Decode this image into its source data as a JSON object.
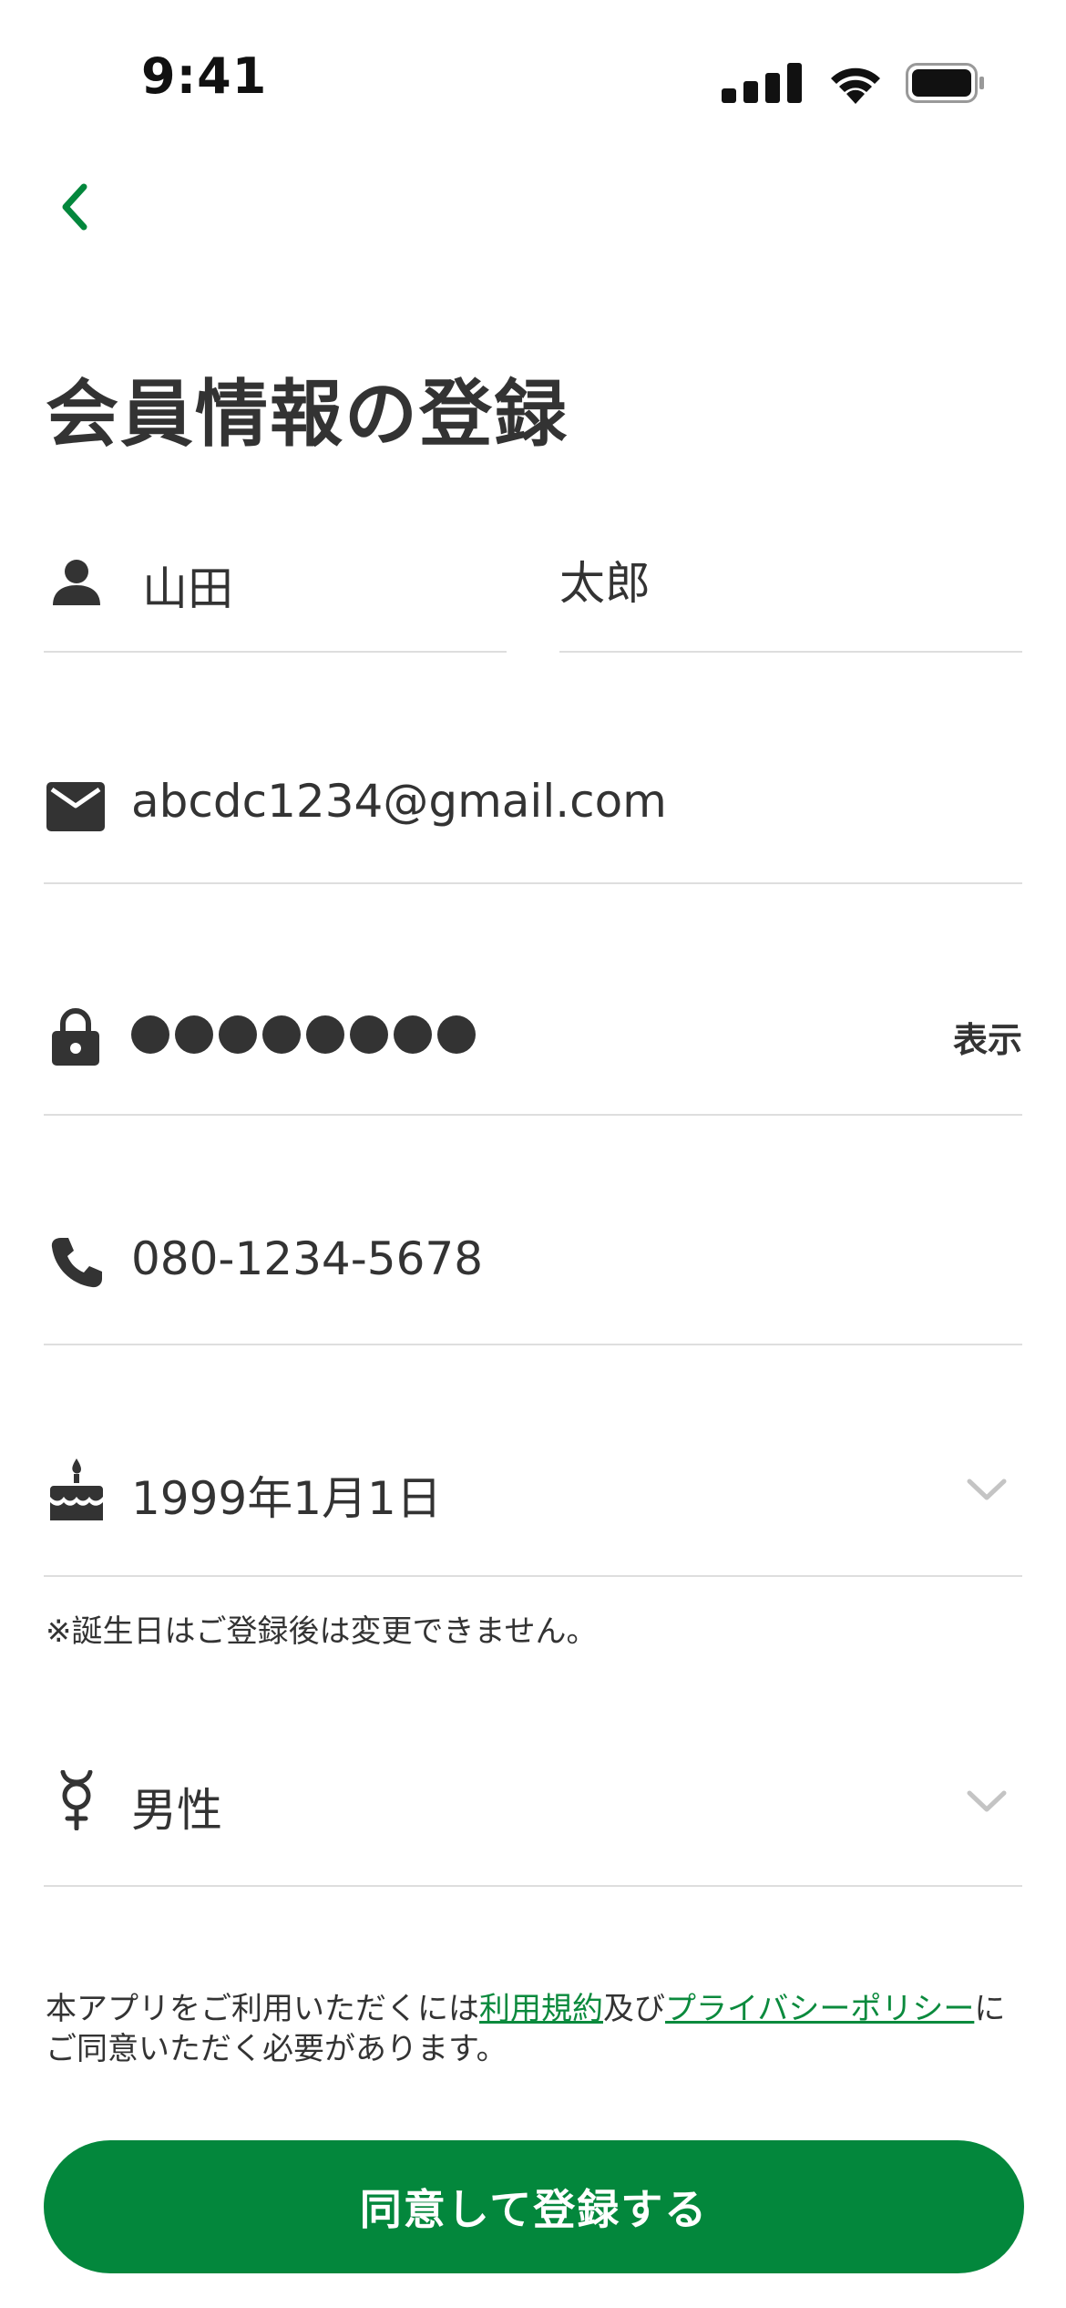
{
  "status_bar": {
    "time": "9:41"
  },
  "header": {
    "back_icon": "chevron-left-icon",
    "title": "会員情報の登録"
  },
  "form": {
    "last_name": "山田",
    "first_name": "太郎",
    "email": "abcdc1234@gmail.com",
    "password_dot_count": 8,
    "show_password_label": "表示",
    "phone": "080-1234-5678",
    "birthday": "1999年1月1日",
    "birthday_note": "※誕生日はご登録後は変更できません。",
    "gender": "男性"
  },
  "terms": {
    "prefix": "本アプリをご利用いただくには",
    "terms_link": "利用規約",
    "middle": "及び",
    "privacy_link": "プライバシーポリシー",
    "suffix": "にご同意いただく必要があります。"
  },
  "submit_label": "同意して登録する",
  "colors": {
    "accent": "#03873c",
    "text": "#333333",
    "divider": "#dedede"
  }
}
